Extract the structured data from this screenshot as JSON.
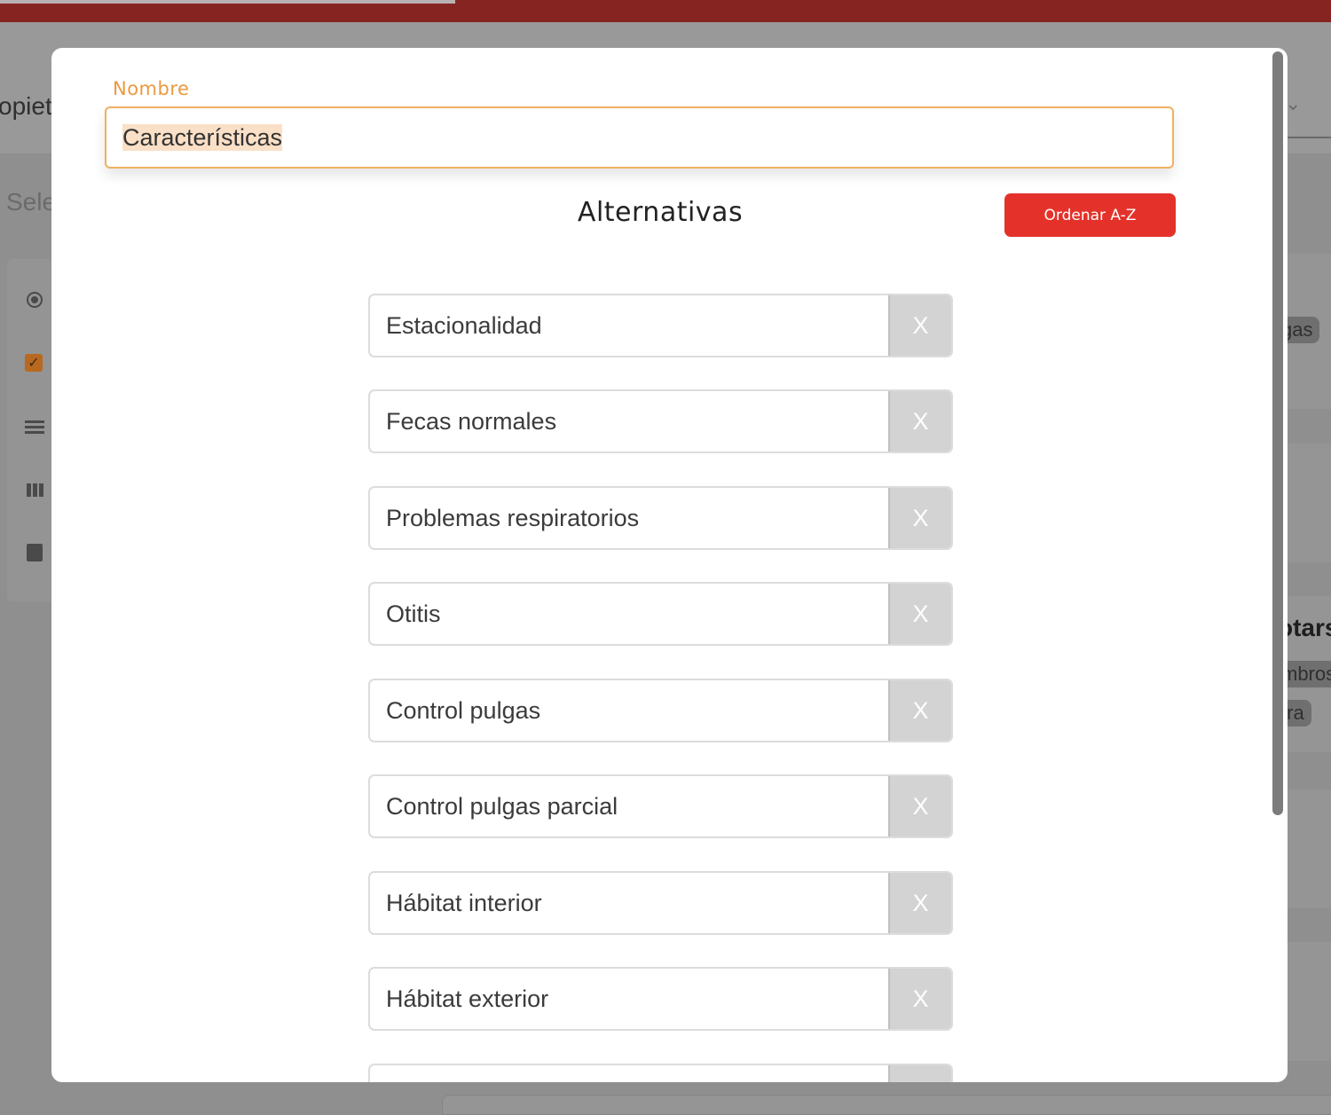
{
  "background": {
    "partial_texts": {
      "left_heading": "opiet",
      "left_select": "Sele",
      "right_chip_1": "gas",
      "right_bold": "otars",
      "right_chip_2": "mbros",
      "right_chip_3": "tra"
    },
    "sidebar_icons": [
      "radio-icon",
      "checkbox-icon",
      "list-icon",
      "columns-icon",
      "clipboard-icon"
    ]
  },
  "modal": {
    "name_label": "Nombre",
    "name_value": "Características",
    "section_title": "Alternativas",
    "sort_button_label": "Ordenar A-Z",
    "remove_label": "X",
    "alternatives": [
      "Estacionalidad",
      "Fecas normales",
      "Problemas respiratorios",
      "Otitis",
      "Control pulgas",
      "Control pulgas parcial",
      "Hábitat interior",
      "Hábitat exterior",
      ""
    ]
  },
  "colors": {
    "accent_orange": "#eb9940",
    "sort_button": "#e4322b",
    "topbar": "#862422",
    "remove_button": "#d3d3d3"
  }
}
